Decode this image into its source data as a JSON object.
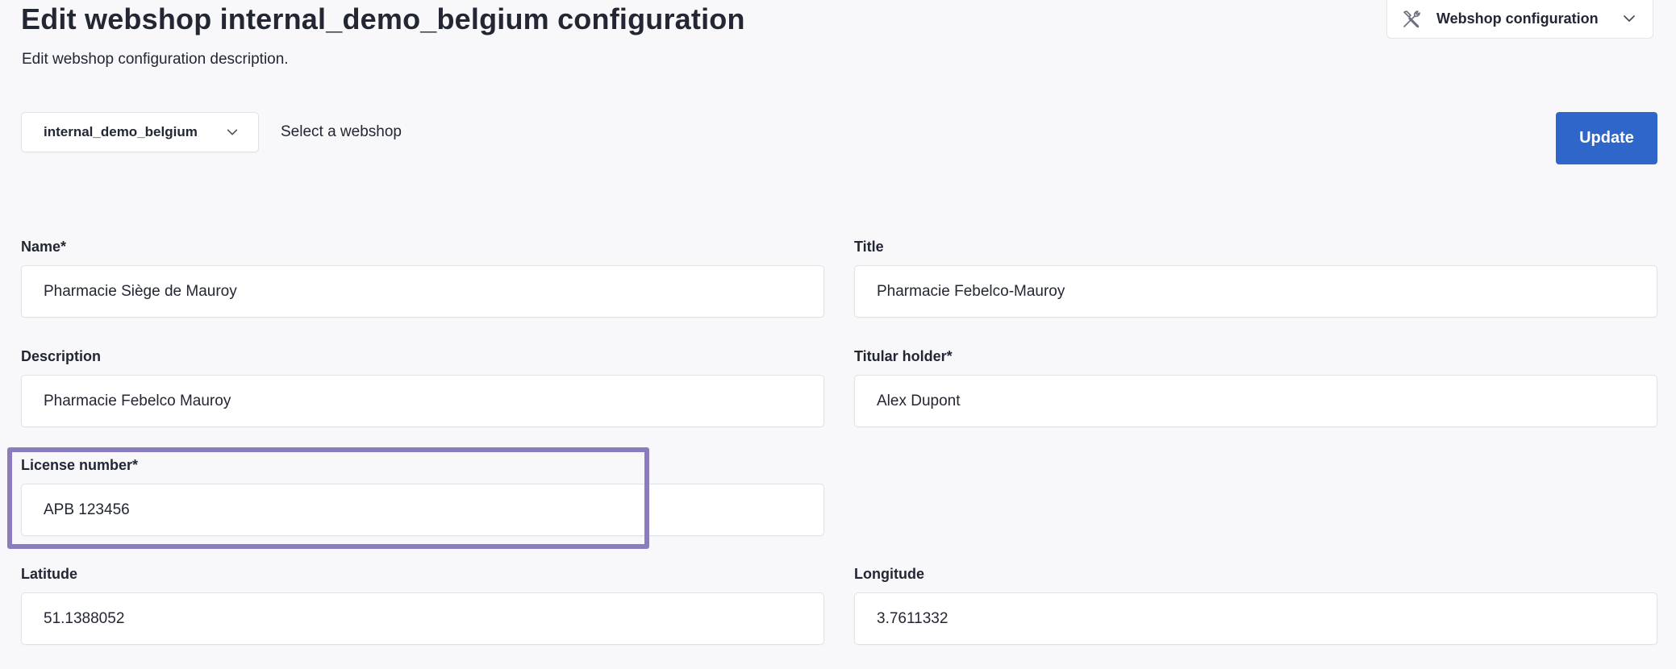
{
  "header": {
    "title": "Edit webshop internal_demo_belgium configuration",
    "subtitle": "Edit webshop configuration description."
  },
  "top_menu": {
    "label": "Webshop configuration",
    "icon": "tools-icon"
  },
  "webshop_select": {
    "value": "internal_demo_belgium",
    "label": "Select a webshop"
  },
  "actions": {
    "update_label": "Update"
  },
  "colors": {
    "accent": "#2f66c9",
    "highlight": "#8b7dbd",
    "background": "#f8f8fa"
  },
  "form": {
    "name": {
      "label": "Name*",
      "value": "Pharmacie Siège de Mauroy"
    },
    "title": {
      "label": "Title",
      "value": "Pharmacie Febelco-Mauroy"
    },
    "description": {
      "label": "Description",
      "value": "Pharmacie Febelco Mauroy"
    },
    "titular_holder": {
      "label": "Titular holder*",
      "value": "Alex Dupont"
    },
    "license_number": {
      "label": "License number*",
      "value": "APB 123456"
    },
    "latitude": {
      "label": "Latitude",
      "value": "51.1388052"
    },
    "longitude": {
      "label": "Longitude",
      "value": "3.7611332"
    }
  }
}
